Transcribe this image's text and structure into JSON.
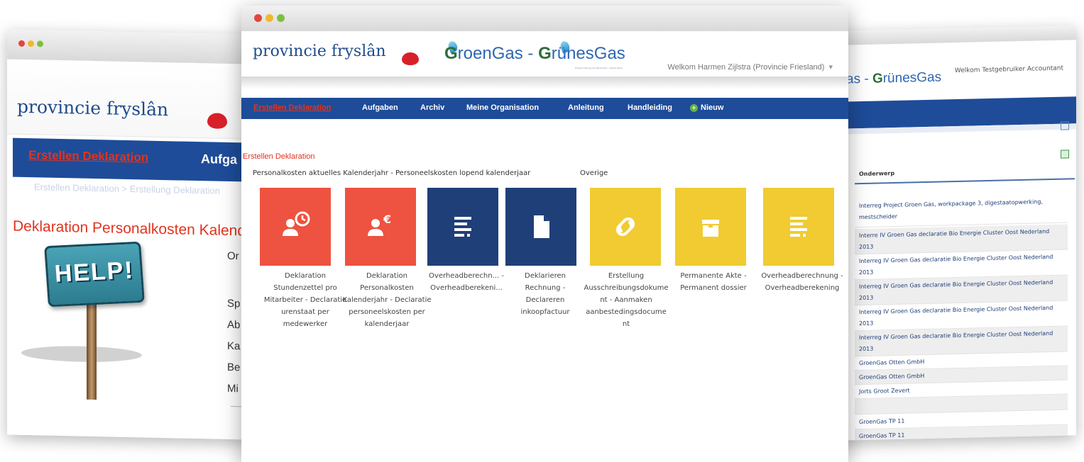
{
  "left_window": {
    "logo": "provincie fryslân",
    "nav": [
      "Erstellen Deklaration",
      "Aufga"
    ],
    "breadcrumb": "Erstellen Deklaration > Erstellung Deklaration",
    "section_title": "Deklaration Personalkosten Kalende",
    "help_sign": "HELP!",
    "side_labels": [
      "Or",
      "Sp",
      "Ab",
      "Ka",
      "Be",
      "Mi"
    ]
  },
  "center_window": {
    "logo": "provincie fryslân",
    "brand": {
      "g1": "G",
      "roen": "roenGas - ",
      "g2": "G",
      "runes": "rünesGas",
      "sub": "Project Interreg IVA Nederland - Deutschland"
    },
    "welcome": "Welkom Harmen Zijlstra (Provincie Friesland)",
    "welcome_caret": "▾",
    "nav": {
      "erstellen": "Erstellen Deklaration",
      "aufgaben": "Aufgaben",
      "archiv": "Archiv",
      "organisation": "Meine Organisation",
      "anleitung": "Anleitung",
      "handleiding": "Handleiding",
      "nieuw": "Nieuw",
      "nieuw_icon": "+"
    },
    "page_title": "Erstellen Deklaration",
    "groups": {
      "personal": "Personalkosten aktuelles Kalenderjahr - Personeelskosten lopend kalenderjaar",
      "overige": "Overige"
    },
    "tiles": [
      {
        "label": "Deklaration Stundenzettel pro Mitarbeiter - Declaratie urenstaat per medewerker",
        "icon": "person-clock-icon",
        "color": "#ee5240"
      },
      {
        "label": "Deklaration Personalkosten Kalenderjahr - Declaratie personeelskosten per kalenderjaar",
        "icon": "person-euro-icon",
        "color": "#ee5240",
        "symbol": "€"
      },
      {
        "label": "Overheadberechn... - Overheadberekeni...",
        "icon": "list-icon",
        "color": "#1f3f78"
      },
      {
        "label": "Deklarieren Rechnung - Declareren inkoopfactuur",
        "icon": "document-icon",
        "color": "#1f3f78"
      },
      {
        "label": "Erstellung Ausschreibungsdokume nt - Aanmaken aanbestedingsdocume nt",
        "icon": "link-icon",
        "color": "#f1cb31"
      },
      {
        "label": "Permanente Akte - Permanent dossier",
        "icon": "archive-box-icon",
        "color": "#f1cb31"
      },
      {
        "label": "Overheadberechnung - Overheadberekening",
        "icon": "list-icon",
        "color": "#f1cb31"
      }
    ]
  },
  "right_window": {
    "brand": {
      "pre": "as - ",
      "g": "G",
      "rest": "rünesGas"
    },
    "welcome": "Welkom Testgebruiker Accountant",
    "column": "Onderwerp",
    "rows": [
      "Interreg Project Groen Gas, workpackage 3, digestaatopwerking, mestscheider",
      "Interre IV Groen Gas declaratie Bio Energie Cluster Oost Nederland 2013",
      "Interreg IV Groen Gas declaratie Bio Energie Cluster Oost Nederland 2013",
      "Interreg IV Groen Gas declaratie Bio Energie Cluster Oost Nederland 2013",
      "Interreg IV Groen Gas declaratie Bio Energie Cluster Oost Nederland 2013",
      "Interreg IV Groen Gas declaratie Bio Energie Cluster Oost Nederland 2013",
      "GroenGas Otten GmbH",
      "GroenGas Otten GmbH",
      "Jorts Groot Zevert",
      "",
      "GroenGas TP 11",
      "GroenGas TP 11"
    ]
  }
}
